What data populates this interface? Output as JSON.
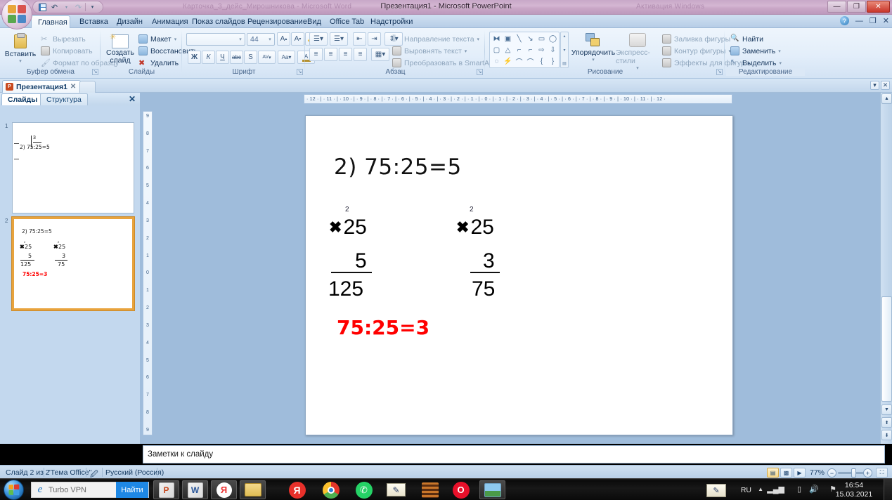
{
  "window": {
    "title": "Презентация1 - Microsoft PowerPoint",
    "ghost_left": "Карточка_3_дейс_Мирошникова - Microsoft Word",
    "ghost_right": "Активация Windows",
    "minimize": "—",
    "restore": "❐",
    "close": "✕"
  },
  "quick_access": {
    "save": "save-icon",
    "undo": "↶",
    "redo": "↷",
    "more": "▾"
  },
  "ribbon": {
    "tabs": [
      {
        "label": "Главная",
        "active": true
      },
      {
        "label": "Вставка",
        "active": false
      },
      {
        "label": "Дизайн",
        "active": false
      },
      {
        "label": "Анимация",
        "active": false
      },
      {
        "label": "Показ слайдов",
        "active": false
      },
      {
        "label": "Рецензирование",
        "active": false
      },
      {
        "label": "Вид",
        "active": false
      },
      {
        "label": "Office Tab",
        "active": false
      },
      {
        "label": "Надстройки",
        "active": false
      }
    ],
    "help_icon": "?",
    "win_min": "—",
    "win_restore": "❐",
    "win_close": "✕",
    "groups": {
      "clipboard": {
        "title": "Буфер обмена",
        "paste": "Вставить",
        "cut": "Вырезать",
        "copy": "Копировать",
        "format_painter": "Формат по образцу"
      },
      "slides": {
        "title": "Слайды",
        "new_slide": "Создать\nслайд",
        "new_slide_l1": "Создать",
        "new_slide_l2": "слайд",
        "layout": "Макет",
        "reset": "Восстановить",
        "delete": "Удалить"
      },
      "font": {
        "title": "Шрифт",
        "font_name": "",
        "font_name_placeholder": "",
        "font_size": "44",
        "grow": "A",
        "shrink": "A",
        "clear_format": "clear-format-icon",
        "bold": "Ж",
        "italic": "К",
        "underline": "Ч",
        "strike": "abc",
        "shadow": "S",
        "spacing": "AV",
        "case": "Aa",
        "color": "A"
      },
      "paragraph": {
        "title": "Абзац",
        "text_direction": "Направление текста",
        "align_text": "Выровнять текст",
        "smartart": "Преобразовать в SmartArt"
      },
      "drawing": {
        "title": "Рисование",
        "arrange": "Упорядочить",
        "quick_styles": "Экспресс-стили",
        "shape_fill": "Заливка фигуры",
        "shape_outline": "Контур фигуры",
        "shape_effects": "Эффекты для фигур",
        "shapes": [
          "⧓",
          "▣",
          "╲",
          "↘",
          "▭",
          "◯",
          "▢",
          "△",
          "⌐",
          "⌐",
          "⇨",
          "⇩",
          "◌",
          "⚡",
          "⌒",
          "⌒",
          "{",
          "}"
        ]
      },
      "editing": {
        "title": "Редактирование",
        "find": "Найти",
        "replace": "Заменить",
        "select": "Выделить"
      }
    }
  },
  "doc_tabs": {
    "tabs": [
      {
        "label": "Презентация1",
        "close": "✕",
        "active": true
      }
    ],
    "right_buttons": [
      "▾",
      "✕"
    ]
  },
  "left_pane": {
    "tabs": [
      {
        "label": "Слайды",
        "active": true
      },
      {
        "label": "Структура",
        "active": false
      }
    ],
    "close": "✕",
    "thumbnails": [
      {
        "number": "1",
        "selected": false,
        "title": "2) 75:25=5"
      },
      {
        "number": "2",
        "selected": true,
        "title": "2) 75:25=5",
        "answer": "75:25=3"
      }
    ]
  },
  "rulers": {
    "horizontal": "· 12 · | · 11 · | · 10 · | · 9 · | · 8 · | · 7 · | · 6 · | · 5 · | · 4 · | · 3 · | · 2 · | · 1 · | · 0 · | · 1 · | · 2 · | · 3 · | · 4 · | · 5 · | · 6 · | · 7 · | · 8 · | · 9 · | · 10 · | · 11 · | · 12 ·",
    "h_labels": [
      "12",
      "11",
      "10",
      "9",
      "8",
      "7",
      "6",
      "5",
      "4",
      "3",
      "2",
      "1",
      "0",
      "1",
      "2",
      "3",
      "4",
      "5",
      "6",
      "7",
      "8",
      "9",
      "10",
      "11",
      "12"
    ],
    "v_labels": [
      "9",
      "8",
      "7",
      "6",
      "5",
      "4",
      "3",
      "2",
      "1",
      "0",
      "1",
      "2",
      "3",
      "4",
      "5",
      "6",
      "7",
      "8",
      "9"
    ]
  },
  "slide": {
    "title": "2) 75:25=5",
    "columns": [
      {
        "carry": "2",
        "operator": "✖",
        "multiplicand": "25",
        "multiplier": "5",
        "product": "125"
      },
      {
        "carry": "2",
        "operator": "✖",
        "multiplicand": "25",
        "multiplier": "3",
        "product": "75"
      }
    ],
    "answer": "75:25=3",
    "answer_color": "#ff0000"
  },
  "notes": {
    "text": "Заметки к слайду"
  },
  "status_bar": {
    "slide_counter": "Слайд 2 из 2",
    "theme": "\"Тема Office\"",
    "spell_icon": "spell-check-icon",
    "language": "Русский (Россия)",
    "zoom": "77%",
    "zoom_out": "−",
    "zoom_in": "+",
    "fit_slide": "fit-to-window-icon",
    "view_buttons": [
      "normal-view-icon",
      "sorter-view-icon",
      "slideshow-view-icon"
    ]
  },
  "taskbar": {
    "start": "start-orb",
    "search": {
      "value": "Turbo VPN",
      "button": "Найти",
      "browser_icon": "internet-explorer-icon"
    },
    "buttons": [
      {
        "name": "powerpoint",
        "glyph": "P",
        "active": true
      },
      {
        "name": "word",
        "glyph": "W",
        "active": false
      },
      {
        "name": "yandex-browser",
        "glyph": "Я",
        "active": false
      },
      {
        "name": "file-explorer",
        "glyph": "📁",
        "active": false
      },
      {
        "name": "yandex",
        "glyph": "Я",
        "active": false
      },
      {
        "name": "google-chrome",
        "glyph": "◉",
        "active": false
      },
      {
        "name": "whatsapp",
        "glyph": "✆",
        "active": false
      },
      {
        "name": "notepad-pen",
        "glyph": "✎",
        "active": false
      },
      {
        "name": "media-app",
        "glyph": "≡",
        "active": false
      },
      {
        "name": "opera",
        "glyph": "O",
        "active": false
      },
      {
        "name": "photo-viewer",
        "glyph": "🖼",
        "active": true
      }
    ],
    "tray": {
      "pen_icon": "pen-tablet-icon",
      "language": "RU",
      "expand": "▲",
      "network": "network-icon",
      "battery": "battery-icon",
      "volume": "volume-icon",
      "action_center": "flag-icon",
      "time": "16:54",
      "date": "15.03.2021"
    }
  }
}
